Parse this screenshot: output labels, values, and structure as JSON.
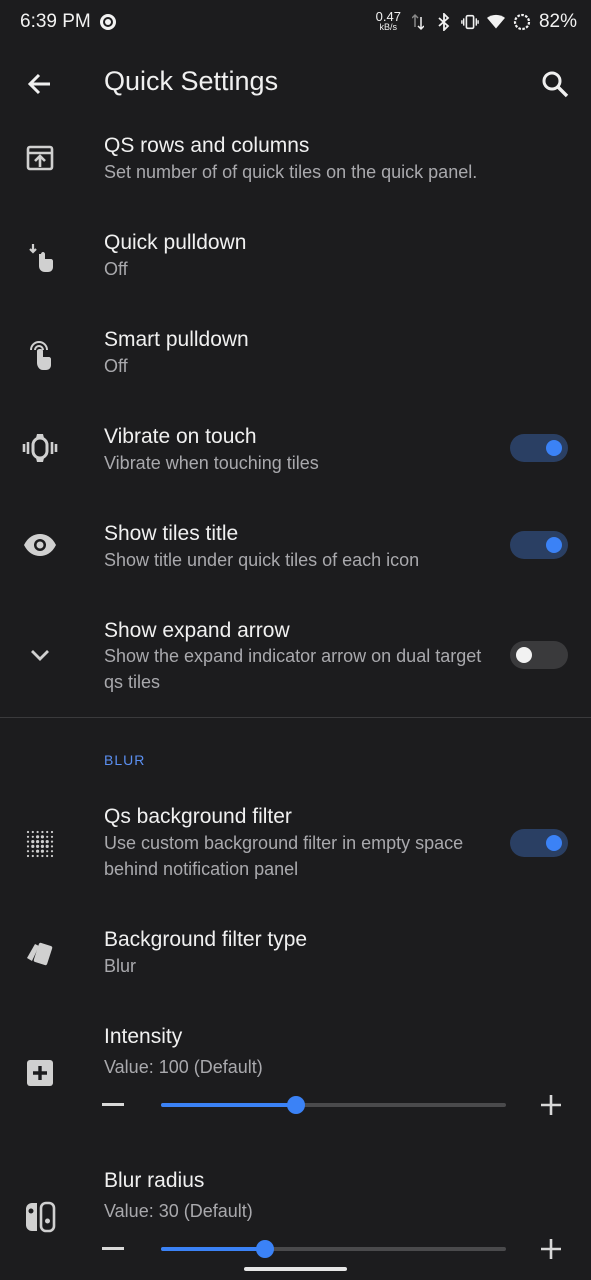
{
  "status_bar": {
    "time": "6:39 PM",
    "net_speed_value": "0.47",
    "net_speed_unit": "kB/s",
    "battery": "82%"
  },
  "header": {
    "title": "Quick Settings"
  },
  "items": [
    {
      "title": "QS rows and columns",
      "summary": "Set number of of quick tiles on the quick panel."
    },
    {
      "title": "Quick pulldown",
      "summary": "Off"
    },
    {
      "title": "Smart pulldown",
      "summary": "Off"
    },
    {
      "title": "Vibrate on touch",
      "summary": "Vibrate when touching tiles",
      "enabled": true
    },
    {
      "title": "Show tiles title",
      "summary": "Show title under quick tiles of each icon",
      "enabled": true
    },
    {
      "title": "Show expand arrow",
      "summary": "Show the expand indicator arrow on dual target qs tiles",
      "enabled": false
    }
  ],
  "blur_section": {
    "header": "BLUR",
    "items": [
      {
        "title": "Qs background filter",
        "summary": "Use custom background filter in empty space behind notification panel",
        "enabled": true
      },
      {
        "title": "Background filter type",
        "summary": "Blur"
      }
    ],
    "sliders": [
      {
        "title": "Intensity",
        "value_text": "Value: 100  (Default)",
        "fraction": 0.39
      },
      {
        "title": "Blur radius",
        "value_text": "Value: 30  (Default)",
        "fraction": 0.3
      }
    ]
  },
  "colors": {
    "background": "#1c1c1e",
    "accent": "#3b82f6",
    "toggle_track_on": "#2a3f63",
    "secondary_text": "#a9a9ad"
  },
  "icons": [
    "arrow-back-icon",
    "search-icon",
    "qs-rows-icon",
    "touch-down-icon",
    "touch-gesture-icon",
    "vibrate-icon",
    "eye-icon",
    "chevron-down-icon",
    "dots-grid-icon",
    "cards-icon",
    "add-box-icon",
    "switch-icon"
  ]
}
